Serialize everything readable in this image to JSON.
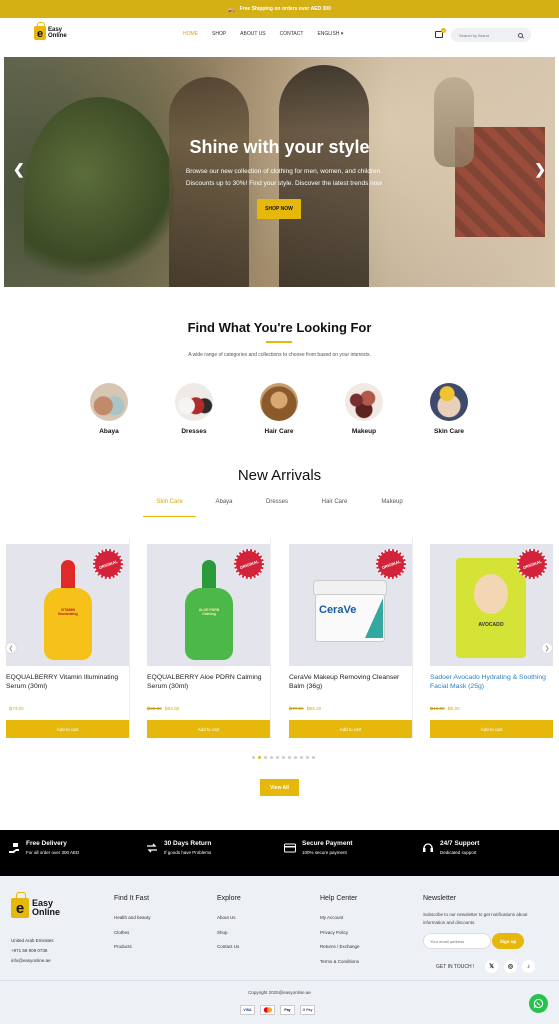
{
  "promo": {
    "icon": "truck-icon",
    "text": "Free Shipping on orders over AED 300"
  },
  "header": {
    "logo_line1": "Easy",
    "logo_line2": "Online",
    "logo_letter": "e",
    "nav": [
      "HOME",
      "SHOP",
      "ABOUT US",
      "CONTACT",
      "ENGLISH ▾"
    ],
    "active_nav": "HOME",
    "cart_count": "0",
    "search_placeholder": "Search by Brand"
  },
  "hero": {
    "title": "Shine with your style",
    "subtitle_line1": "Browse our new collection of clothing for men, women, and children.",
    "subtitle_line2": "Discounts up to 30%! Find your style. Discover the latest trends now",
    "button": "SHOP NOW",
    "prev": "❮",
    "next": "❯"
  },
  "categories_section": {
    "title": "Find What You're Looking For",
    "subtitle": "A wide range of categories and collections to choose from based on your interests.",
    "items": [
      {
        "label": "Abaya",
        "colors": [
          "#c08a6b",
          "#a8c4c4"
        ]
      },
      {
        "label": "Dresses",
        "colors": [
          "#b02b2b",
          "#f4f4f4"
        ]
      },
      {
        "label": "Hair Care",
        "colors": [
          "#8a5a2a",
          "#d9a870"
        ]
      },
      {
        "label": "Makeup",
        "colors": [
          "#7a2f2f",
          "#f3e9e4"
        ]
      },
      {
        "label": "Skin Care",
        "colors": [
          "#3d4a6b",
          "#e8d1b8"
        ]
      }
    ]
  },
  "arrivals": {
    "title": "New Arrivals",
    "tabs": [
      "Skin Care",
      "Abaya",
      "Dresses",
      "Hair Care",
      "Makeup"
    ],
    "active_tab": "Skin Care",
    "badge_text": "ORIGINAL",
    "cart_label": "Add to cart",
    "products": [
      {
        "name": "EQQUALBERRY Vitamin Illuminating Serum (30ml)",
        "old_price": "",
        "price": "₿73.00",
        "color": "#f6c21a",
        "cap": "#e02a2a",
        "label": "VITAMIN Illuminating"
      },
      {
        "name": "EQQUALBERRY Aloe PDRN Calming Serum (30ml)",
        "old_price": "₿80.00",
        "price": "₿54.00",
        "color": "#4db84a",
        "cap": "#2a9a3a",
        "label": "ALOE PDRN Calming"
      },
      {
        "name": "CeraVe Makeup Removing Cleanser Balm (36g)",
        "old_price": "₿77.00",
        "price": "₿65.20",
        "color": "",
        "cap": "",
        "label": "CeraVe"
      },
      {
        "name": "Sadoer Avocado Hydrating & Soothing Facial Mask (25g)",
        "old_price": "₿15.00",
        "price": "₿5.00",
        "color": "",
        "cap": "",
        "label": "AVOCADO"
      }
    ],
    "nav_prev": "❮",
    "nav_next": "❯",
    "dots": 11,
    "active_dot": 1,
    "view_all": "View All"
  },
  "features": [
    {
      "icon": "delivery-hand-icon",
      "title": "Free Delivery",
      "sub": "For all order over 300 AED"
    },
    {
      "icon": "return-arrows-icon",
      "title": "30 Days Return",
      "sub": "If goods have Problems"
    },
    {
      "icon": "credit-card-icon",
      "title": "Secure Payment",
      "sub": "100% secure payment"
    },
    {
      "icon": "headset-icon",
      "title": "24/7 Support",
      "sub": "Dedicated support"
    }
  ],
  "footer": {
    "country": "United Arab Emirates",
    "phone": "+971 58 909 0738",
    "email": "info@easyonline.ae",
    "find_title": "Find It Fast",
    "find_links": [
      "Health and beauty",
      "Clothes",
      "Products"
    ],
    "explore_title": "Explore",
    "explore_links": [
      "About Us",
      "Shop",
      "Contact Us"
    ],
    "help_title": "Help Center",
    "help_links": [
      "My Account",
      "Privacy Policy",
      "Returns / Exchange",
      "Terms & Conditions"
    ],
    "newsletter_title": "Newsletter",
    "newsletter_sub": "Subscribe to our newsletter to get notifications about information and discounts.",
    "email_placeholder": "Your email address",
    "signup": "Sign up",
    "touch": "GET IN TOUCH !",
    "social": [
      "𝕏",
      "◎",
      "♪"
    ],
    "copyright": "Copyright 2025@easyonline.ae",
    "payments": [
      "VISA",
      "MC",
      "Pay",
      "G Pay"
    ]
  },
  "colors": {
    "accent": "#e5b80b",
    "dark": "#000000",
    "footer_bg": "#edf0f5",
    "whatsapp": "#27c24c"
  }
}
